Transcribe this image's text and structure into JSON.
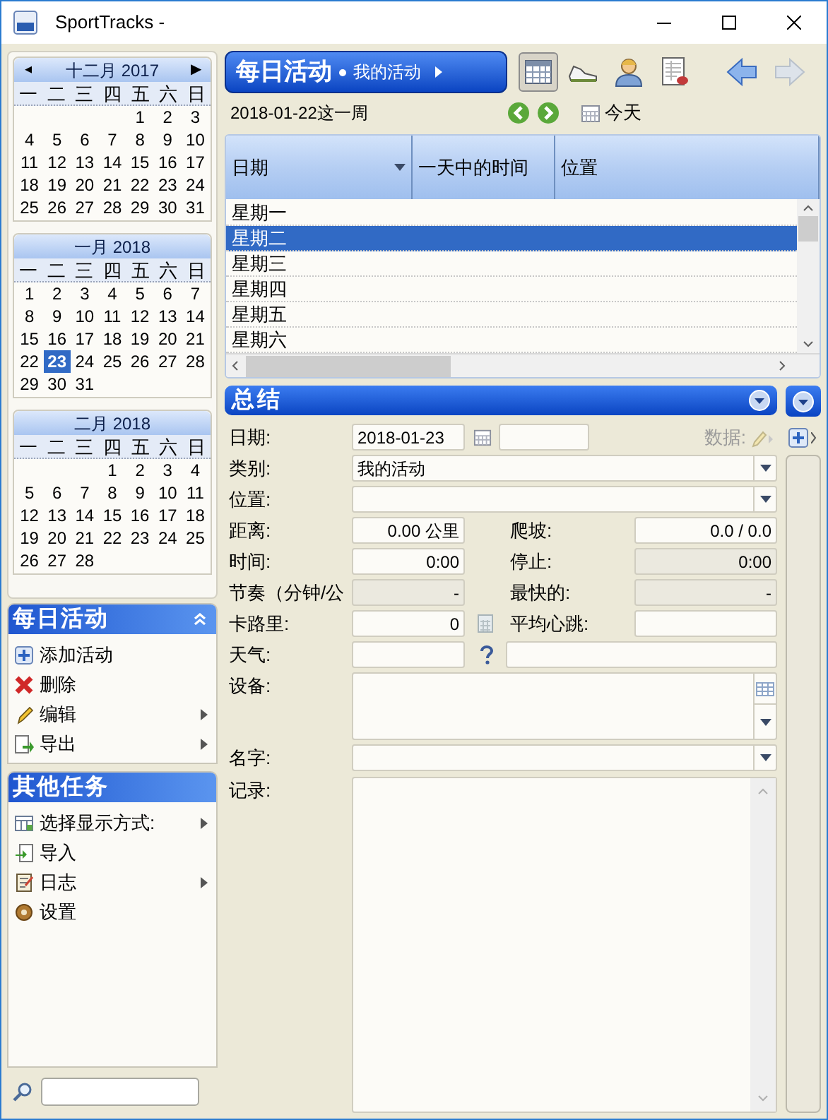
{
  "window": {
    "title": "SportTracks -"
  },
  "calendars": [
    {
      "month": "十二月 2017",
      "prev": "◂",
      "next": "▶",
      "weekdays": [
        "一",
        "二",
        "三",
        "四",
        "五",
        "六",
        "日"
      ],
      "weeks": [
        [
          {
            "day": "1",
            "selected": false
          },
          {
            "day": "2",
            "selected": false
          },
          {
            "day": "3",
            "selected": false
          }
        ],
        [
          {
            "day": "4",
            "selected": false
          },
          {
            "day": "5",
            "selected": false
          },
          {
            "day": "6",
            "selected": false
          },
          {
            "day": "7",
            "selected": false
          },
          {
            "day": "8",
            "selected": false
          },
          {
            "day": "9",
            "selected": false
          },
          {
            "day": "10",
            "selected": false
          }
        ],
        [
          {
            "day": "11",
            "selected": false
          },
          {
            "day": "12",
            "selected": false
          },
          {
            "day": "13",
            "selected": false
          },
          {
            "day": "14",
            "selected": false
          },
          {
            "day": "15",
            "selected": false
          },
          {
            "day": "16",
            "selected": false
          },
          {
            "day": "17",
            "selected": false
          }
        ],
        [
          {
            "day": "18",
            "selected": false
          },
          {
            "day": "19",
            "selected": false
          },
          {
            "day": "20",
            "selected": false
          },
          {
            "day": "21",
            "selected": false
          },
          {
            "day": "22",
            "selected": false
          },
          {
            "day": "23",
            "selected": false
          },
          {
            "day": "24",
            "selected": false
          }
        ],
        [
          {
            "day": "25",
            "selected": false
          },
          {
            "day": "26",
            "selected": false
          },
          {
            "day": "27",
            "selected": false
          },
          {
            "day": "28",
            "selected": false
          },
          {
            "day": "29",
            "selected": false
          },
          {
            "day": "30",
            "selected": false
          },
          {
            "day": "31",
            "selected": false
          }
        ]
      ]
    },
    {
      "month": "一月 2018",
      "weekdays": [
        "一",
        "二",
        "三",
        "四",
        "五",
        "六",
        "日"
      ],
      "weeks": [
        [
          {
            "day": "1",
            "selected": false
          },
          {
            "day": "2",
            "selected": false
          },
          {
            "day": "3",
            "selected": false
          },
          {
            "day": "4",
            "selected": false
          },
          {
            "day": "5",
            "selected": false
          },
          {
            "day": "6",
            "selected": false
          },
          {
            "day": "7",
            "selected": false
          }
        ],
        [
          {
            "day": "8",
            "selected": false
          },
          {
            "day": "9",
            "selected": false
          },
          {
            "day": "10",
            "selected": false
          },
          {
            "day": "11",
            "selected": false
          },
          {
            "day": "12",
            "selected": false
          },
          {
            "day": "13",
            "selected": false
          },
          {
            "day": "14",
            "selected": false
          }
        ],
        [
          {
            "day": "15",
            "selected": false
          },
          {
            "day": "16",
            "selected": false
          },
          {
            "day": "17",
            "selected": false
          },
          {
            "day": "18",
            "selected": false
          },
          {
            "day": "19",
            "selected": false
          },
          {
            "day": "20",
            "selected": false
          },
          {
            "day": "21",
            "selected": false
          }
        ],
        [
          {
            "day": "22",
            "selected": false
          },
          {
            "day": "23",
            "selected": true
          },
          {
            "day": "24",
            "selected": false
          },
          {
            "day": "25",
            "selected": false
          },
          {
            "day": "26",
            "selected": false
          },
          {
            "day": "27",
            "selected": false
          },
          {
            "day": "28",
            "selected": false
          }
        ],
        [
          {
            "day": "29",
            "selected": false
          },
          {
            "day": "30",
            "selected": false
          },
          {
            "day": "31",
            "selected": false
          }
        ]
      ]
    },
    {
      "month": "二月 2018",
      "weekdays": [
        "一",
        "二",
        "三",
        "四",
        "五",
        "六",
        "日"
      ],
      "weeks": [
        [
          {
            "day": "1",
            "selected": false
          },
          {
            "day": "2",
            "selected": false
          },
          {
            "day": "3",
            "selected": false
          },
          {
            "day": "4",
            "selected": false
          }
        ],
        [
          {
            "day": "5",
            "selected": false
          },
          {
            "day": "6",
            "selected": false
          },
          {
            "day": "7",
            "selected": false
          },
          {
            "day": "8",
            "selected": false
          },
          {
            "day": "9",
            "selected": false
          },
          {
            "day": "10",
            "selected": false
          },
          {
            "day": "11",
            "selected": false
          }
        ],
        [
          {
            "day": "12",
            "selected": false
          },
          {
            "day": "13",
            "selected": false
          },
          {
            "day": "14",
            "selected": false
          },
          {
            "day": "15",
            "selected": false
          },
          {
            "day": "16",
            "selected": false
          },
          {
            "day": "17",
            "selected": false
          },
          {
            "day": "18",
            "selected": false
          }
        ],
        [
          {
            "day": "19",
            "selected": false
          },
          {
            "day": "20",
            "selected": false
          },
          {
            "day": "21",
            "selected": false
          },
          {
            "day": "22",
            "selected": false
          },
          {
            "day": "23",
            "selected": false
          },
          {
            "day": "24",
            "selected": false
          },
          {
            "day": "25",
            "selected": false
          }
        ],
        [
          {
            "day": "26",
            "selected": false
          },
          {
            "day": "27",
            "selected": false
          },
          {
            "day": "28",
            "selected": false
          }
        ]
      ]
    }
  ],
  "tasks": [
    {
      "title": "每日活动",
      "collapsible": true,
      "items": [
        {
          "label": "添加活动",
          "kind": "add",
          "submenu": false
        },
        {
          "label": "删除",
          "kind": "delete",
          "submenu": false
        },
        {
          "label": "编辑",
          "kind": "edit",
          "submenu": true
        },
        {
          "label": "导出",
          "kind": "export",
          "submenu": true
        }
      ]
    },
    {
      "title": "其他任务",
      "collapsible": false,
      "items": [
        {
          "label": "选择显示方式:",
          "kind": "view",
          "submenu": true
        },
        {
          "label": "导入",
          "kind": "import",
          "submenu": false
        },
        {
          "label": "日志",
          "kind": "log",
          "submenu": true
        },
        {
          "label": "设置",
          "kind": "settings",
          "submenu": false
        }
      ]
    }
  ],
  "header": {
    "title": "每日活动",
    "subtitle": "我的活动"
  },
  "toolbar": [
    {
      "kind": "calendar",
      "selected": true
    },
    {
      "kind": "shoe",
      "selected": false
    },
    {
      "kind": "person",
      "selected": false
    },
    {
      "kind": "report",
      "selected": false
    }
  ],
  "nav": [
    {
      "kind": "back",
      "disabled": false
    },
    {
      "kind": "forward",
      "disabled": true
    }
  ],
  "week": {
    "label": "2018-01-22这一周",
    "today": "今天"
  },
  "table": {
    "columns": [
      {
        "label": "日期",
        "sorted": true
      },
      {
        "label": "一天中的时间",
        "sorted": false
      },
      {
        "label": "位置",
        "sorted": false
      }
    ],
    "rows": [
      {
        "day": "星期一",
        "selected": false
      },
      {
        "day": "星期二",
        "selected": true
      },
      {
        "day": "星期三",
        "selected": false
      },
      {
        "day": "星期四",
        "selected": false
      },
      {
        "day": "星期五",
        "selected": false
      },
      {
        "day": "星期六",
        "selected": false
      }
    ]
  },
  "summary": {
    "title": "总结",
    "rows": [
      {
        "kind": "date",
        "label": "日期:",
        "value": "2018-01-23",
        "data_label": "数据:"
      },
      {
        "kind": "combo",
        "label": "类别:",
        "value": "我的活动"
      },
      {
        "kind": "combo",
        "label": "位置:"
      },
      {
        "kind": "pair",
        "left": {
          "label": "距离:",
          "value": "0.00 公里",
          "disabled": false
        },
        "right": {
          "label": "爬坡:",
          "value": "0.0 / 0.0",
          "disabled": false
        }
      },
      {
        "kind": "pair",
        "left": {
          "label": "时间:",
          "value": "0:00",
          "disabled": false
        },
        "right": {
          "label": "停止:",
          "value": "0:00",
          "disabled": true
        }
      },
      {
        "kind": "pair",
        "left": {
          "label": "节奏（分钟/公",
          "value": "-",
          "disabled": true
        },
        "right": {
          "label": "最快的:",
          "value": "-",
          "disabled": true
        }
      },
      {
        "kind": "calories",
        "left": {
          "label": "卡路里:",
          "value": "0",
          "disabled": false
        },
        "right": {
          "label": "平均心跳:",
          "disabled": false
        }
      },
      {
        "kind": "weather",
        "label": "天气:"
      },
      {
        "kind": "equipment",
        "label": "设备:"
      },
      {
        "kind": "combo",
        "label": "名字:"
      },
      {
        "kind": "notes",
        "label": "记录:"
      }
    ]
  }
}
